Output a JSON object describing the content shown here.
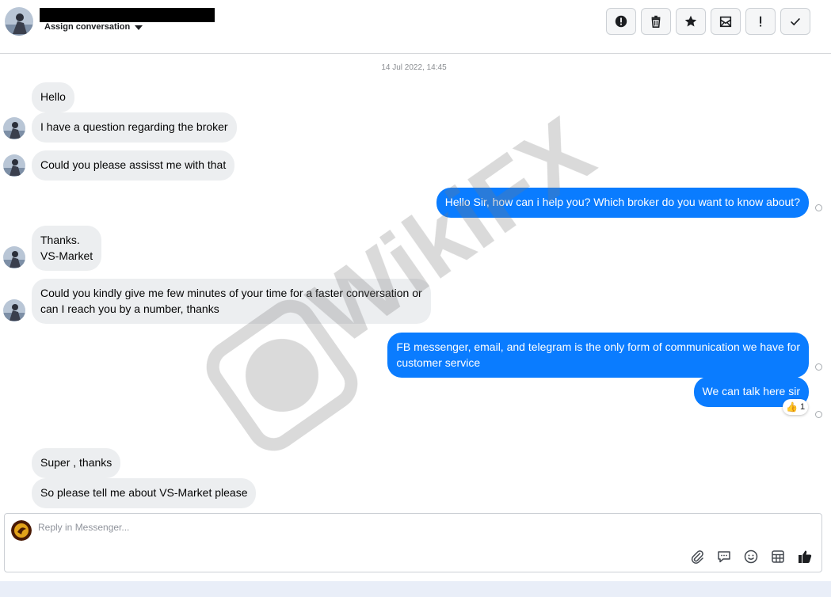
{
  "header": {
    "assign_label": "Assign conversation",
    "actions": [
      {
        "icon": "alert-circle-icon",
        "name": "mark-spam-button"
      },
      {
        "icon": "trash-icon",
        "name": "delete-button"
      },
      {
        "icon": "star-icon",
        "name": "star-button"
      },
      {
        "icon": "envelope-open-icon",
        "name": "mark-unread-button"
      },
      {
        "icon": "exclamation-icon",
        "name": "follow-up-button"
      },
      {
        "icon": "checkmark-icon",
        "name": "mark-done-button"
      }
    ]
  },
  "thread": {
    "date": "14 Jul 2022, 14:45",
    "messages": [
      {
        "dir": "in",
        "text": "Hello"
      },
      {
        "dir": "in",
        "text": "I have a question regarding the broker"
      },
      {
        "dir": "in",
        "text": "Could you please assisst me with that"
      },
      {
        "dir": "out",
        "text": "Hello Sir, how can i help you? Which broker do you want to know about?"
      },
      {
        "dir": "in",
        "text": "Thanks.\nVS-Market"
      },
      {
        "dir": "in",
        "text": "Could you kindly give me few minutes of your time for a faster conversation or\ncan I reach you by a number, thanks"
      },
      {
        "dir": "out",
        "text": "FB messenger, email, and telegram is the only form of communication we have for\ncustomer service"
      },
      {
        "dir": "out",
        "text": "We can talk here sir",
        "reaction": {
          "icon": "thumbs-up-emoji",
          "count": "1"
        }
      },
      {
        "dir": "in",
        "text": "Super , thanks"
      },
      {
        "dir": "in",
        "text": "So please tell me about VS-Market please"
      }
    ]
  },
  "composer": {
    "placeholder": "Reply in Messenger...",
    "tools": [
      "attachment-icon",
      "saved-reply-icon",
      "emoji-icon",
      "template-icon",
      "thumbs-up-icon"
    ]
  },
  "colors": {
    "outgoing": "#0a7cff",
    "incoming": "#eceef0"
  }
}
